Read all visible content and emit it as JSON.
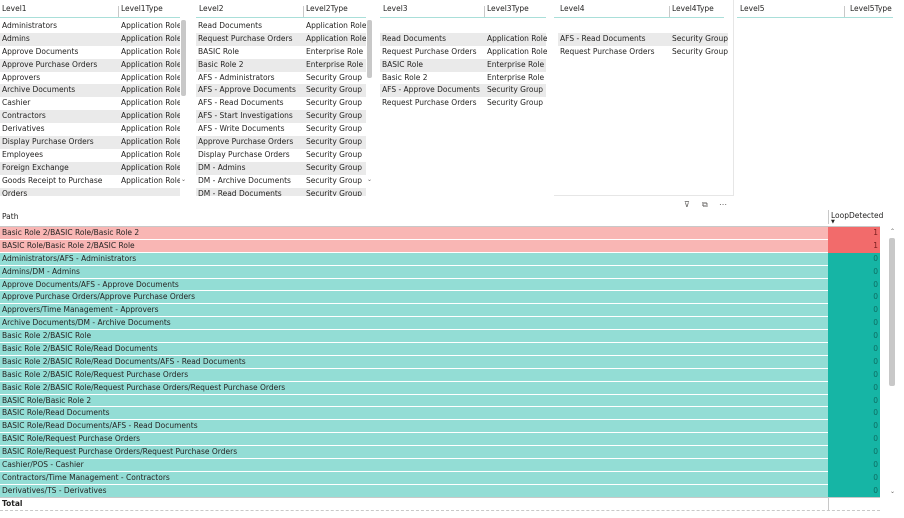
{
  "level1": {
    "col1": "Level1",
    "col2": "Level1Type",
    "rows": [
      [
        "Administrators",
        "Application Role"
      ],
      [
        "Admins",
        "Application Role"
      ],
      [
        "Approve Documents",
        "Application Role"
      ],
      [
        "Approve Purchase Orders",
        "Application Role"
      ],
      [
        "Approvers",
        "Application Role"
      ],
      [
        "Archive Documents",
        "Application Role"
      ],
      [
        "Cashier",
        "Application Role"
      ],
      [
        "Contractors",
        "Application Role"
      ],
      [
        "Derivatives",
        "Application Role"
      ],
      [
        "Display Purchase Orders",
        "Application Role"
      ],
      [
        "Employees",
        "Application Role"
      ],
      [
        "Foreign Exchange",
        "Application Role"
      ],
      [
        "Goods Receipt to Purchase",
        "Application Role"
      ],
      [
        "Orders",
        ""
      ]
    ]
  },
  "level2": {
    "col1": "Level2",
    "col2": "Level2Type",
    "rows": [
      [
        "Read Documents",
        "Application Role"
      ],
      [
        "Request Purchase Orders",
        "Application Role"
      ],
      [
        "BASIC Role",
        "Enterprise Role"
      ],
      [
        "Basic Role 2",
        "Enterprise Role"
      ],
      [
        "AFS - Administrators",
        "Security Group"
      ],
      [
        "AFS - Approve Documents",
        "Security Group"
      ],
      [
        "AFS - Read Documents",
        "Security Group"
      ],
      [
        "AFS - Start Investigations",
        "Security Group"
      ],
      [
        "AFS - Write Documents",
        "Security Group"
      ],
      [
        "Approve Purchase Orders",
        "Security Group"
      ],
      [
        "Display Purchase Orders",
        "Security Group"
      ],
      [
        "DM - Admins",
        "Security Group"
      ],
      [
        "DM - Archive Documents",
        "Security Group"
      ],
      [
        "DM - Read Documents",
        "Security Group"
      ]
    ]
  },
  "level3": {
    "col1": "Level3",
    "col2": "Level3Type",
    "rows": [
      [
        "",
        ""
      ],
      [
        "Read Documents",
        "Application Role"
      ],
      [
        "Request Purchase Orders",
        "Application Role"
      ],
      [
        "BASIC Role",
        "Enterprise Role"
      ],
      [
        "Basic Role 2",
        "Enterprise Role"
      ],
      [
        "AFS - Approve Documents",
        "Security Group"
      ],
      [
        "Request Purchase Orders",
        "Security Group"
      ]
    ]
  },
  "level4": {
    "col1": "Level4",
    "col2": "Level4Type",
    "rows": [
      [
        "",
        ""
      ],
      [
        "AFS - Read Documents",
        "Security Group"
      ],
      [
        "Request Purchase Orders",
        "Security Group"
      ]
    ]
  },
  "level5": {
    "col1": "Level5",
    "col2": "Level5Type"
  },
  "toolbar": {
    "filter_icon": "⊽",
    "focus_icon": "⧉",
    "more_icon": "⋯"
  },
  "main": {
    "col_path": "Path",
    "col_loop": "LoopDetected",
    "total_label": "Total",
    "loop_color": "#f9b6b4",
    "loop_value_color": "#f26b6b",
    "ok_color": "#93ddd5",
    "ok_value_color": "#16b5a5",
    "rows": [
      {
        "path": "Basic Role 2/BASIC Role/Basic Role 2",
        "loop": "1"
      },
      {
        "path": "BASIC Role/Basic Role 2/BASIC Role",
        "loop": "1"
      },
      {
        "path": "Administrators/AFS - Administrators",
        "loop": "0"
      },
      {
        "path": "Admins/DM - Admins",
        "loop": "0"
      },
      {
        "path": "Approve Documents/AFS - Approve Documents",
        "loop": "0"
      },
      {
        "path": "Approve Purchase Orders/Approve Purchase Orders",
        "loop": "0"
      },
      {
        "path": "Approvers/Time Management - Approvers",
        "loop": "0"
      },
      {
        "path": "Archive Documents/DM - Archive Documents",
        "loop": "0"
      },
      {
        "path": "Basic Role 2/BASIC Role",
        "loop": "0"
      },
      {
        "path": "Basic Role 2/BASIC Role/Read Documents",
        "loop": "0"
      },
      {
        "path": "Basic Role 2/BASIC Role/Read Documents/AFS - Read Documents",
        "loop": "0"
      },
      {
        "path": "Basic Role 2/BASIC Role/Request Purchase Orders",
        "loop": "0"
      },
      {
        "path": "Basic Role 2/BASIC Role/Request Purchase Orders/Request Purchase Orders",
        "loop": "0"
      },
      {
        "path": "BASIC Role/Basic Role 2",
        "loop": "0"
      },
      {
        "path": "BASIC Role/Read Documents",
        "loop": "0"
      },
      {
        "path": "BASIC Role/Read Documents/AFS - Read Documents",
        "loop": "0"
      },
      {
        "path": "BASIC Role/Request Purchase Orders",
        "loop": "0"
      },
      {
        "path": "BASIC Role/Request Purchase Orders/Request Purchase Orders",
        "loop": "0"
      },
      {
        "path": "Cashier/POS - Cashier",
        "loop": "0"
      },
      {
        "path": "Contractors/Time Management - Contractors",
        "loop": "0"
      },
      {
        "path": "Derivatives/TS - Derivatives",
        "loop": "0"
      }
    ]
  }
}
